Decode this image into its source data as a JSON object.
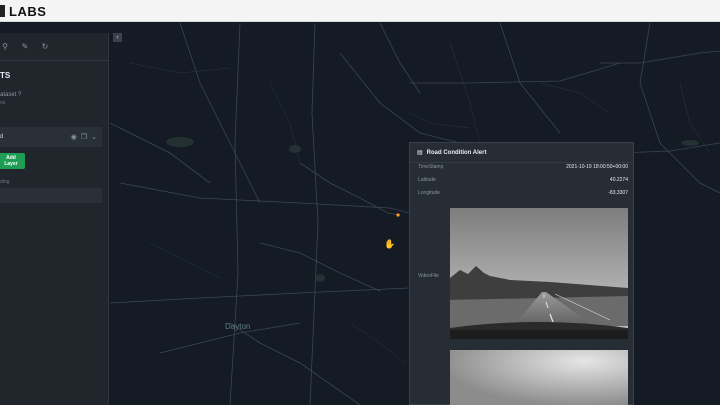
{
  "header": {
    "brand": "LABS"
  },
  "sidebar": {
    "tabs": [
      "⚲",
      "✎",
      "↻"
    ],
    "title": "TS",
    "subtitle": "ataset ?",
    "subtitle2": "ns",
    "layer_name": "d",
    "add_layer_label": "Add Layer",
    "hint": "ding",
    "search_placeholder": ""
  },
  "map": {
    "collapse_label": "‹",
    "city_label": "Dayton"
  },
  "popup": {
    "title": "Road Condition Alert",
    "rows": [
      {
        "key": "TimeStamp",
        "value": "2021-10-19 18:00:50+00:00"
      },
      {
        "key": "Latitude",
        "value": "40.2274"
      },
      {
        "key": "Longitude",
        "value": "-83.3307"
      }
    ],
    "video_label": "VideoFile"
  },
  "colors": {
    "map_bg": "#151b24",
    "road": "#3b4552",
    "panel_bg": "#21262d",
    "accent_green": "#1f9d55",
    "marker": "#ff9a2e"
  }
}
